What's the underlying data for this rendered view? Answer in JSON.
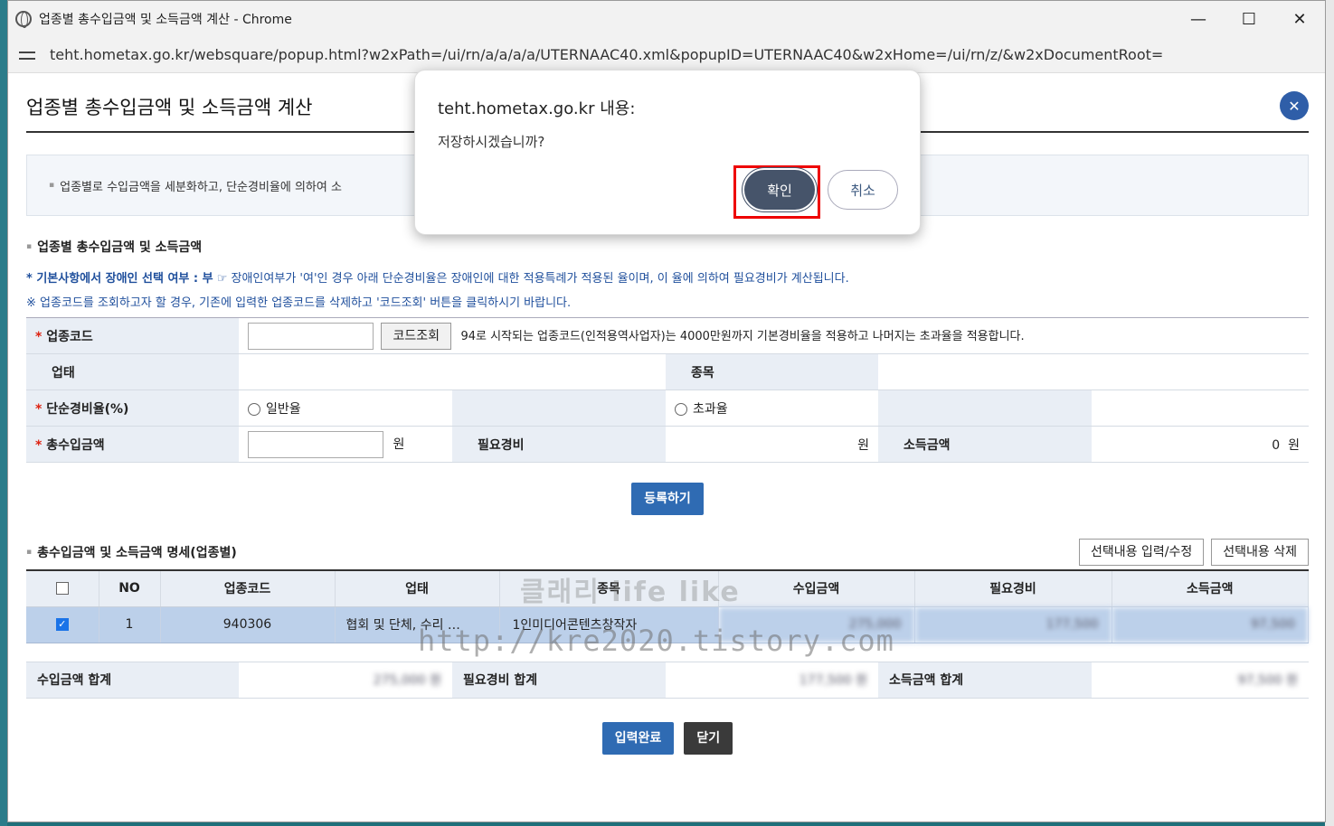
{
  "window": {
    "title": "업종별 총수입금액 및 소득금액 계산 - Chrome",
    "url": "teht.hometax.go.kr/websquare/popup.html?w2xPath=/ui/rn/a/a/a/a/UTERNAAC40.xml&popupID=UTERNAAC40&w2xHome=/ui/rn/z/&w2xDocumentRoot=",
    "minimize": "—",
    "maximize": "☐",
    "close": "✕"
  },
  "popup": {
    "title": "업종별 총수입금액 및 소득금액 계산",
    "close": "✕",
    "notice": "업종별로 수입금액을 세분화하고, 단순경비율에 의하여 소"
  },
  "section1": {
    "title": "업종별 총수입금액 및 소득금액",
    "note1_bold": "* 기본사항에서 장애인 선택 여부 : 부",
    "note1_rest": " ☞ 장애인여부가 '여'인 경우 아래 단순경비율은 장애인에 대한 적용특례가 적용된 율이며, 이 율에 의하여 필요경비가 계산됩니다.",
    "note2": "※ 업종코드를 조회하고자 할 경우, 기존에 입력한 업종코드를 삭제하고 '코드조회' 버튼을 클릭하시기 바랍니다."
  },
  "form": {
    "code_label": "업종코드",
    "code_btn": "코드조회",
    "code_note": "94로 시작되는 업종코드(인적용역사업자)는 4000만원까지 기본경비율을 적용하고 나머지는 초과율을 적용합니다.",
    "uptae_label": "업태",
    "jongmok_label": "종목",
    "rate_label": "단순경비율(%)",
    "rate_normal": "일반율",
    "rate_excess": "초과율",
    "income_label": "총수입금액",
    "won": "원",
    "expense_label": "필요경비",
    "profit_label": "소득금액",
    "profit_value": "0",
    "register_btn": "등록하기"
  },
  "section2": {
    "title": "총수입금액 및 소득금액 명세(업종별)",
    "edit_btn": "선택내용 입력/수정",
    "delete_btn": "선택내용 삭제",
    "columns": [
      "NO",
      "업종코드",
      "업태",
      "종목",
      "수입금액",
      "필요경비",
      "소득금액"
    ],
    "rows": [
      {
        "no": "1",
        "code": "940306",
        "uptae": "협회 및 단체, 수리 …",
        "jongmok": "1인미디어콘텐츠창작자",
        "income": "275,000",
        "expense": "177,500",
        "profit": "97,500"
      }
    ]
  },
  "summary": {
    "income_total_label": "수입금액 합계",
    "income_total": "275,000 원",
    "expense_total_label": "필요경비 합계",
    "expense_total": "177,500 원",
    "profit_total_label": "소득금액 합계",
    "profit_total": "97,500 원"
  },
  "footer": {
    "done_btn": "입력완료",
    "close_btn": "닫기"
  },
  "watermark": {
    "line1": "클래리 life like",
    "line2": "http://kre2020.tistory.com"
  },
  "dialog": {
    "title": "teht.hometax.go.kr 내용:",
    "message": "저장하시겠습니까?",
    "ok": "확인",
    "cancel": "취소"
  }
}
